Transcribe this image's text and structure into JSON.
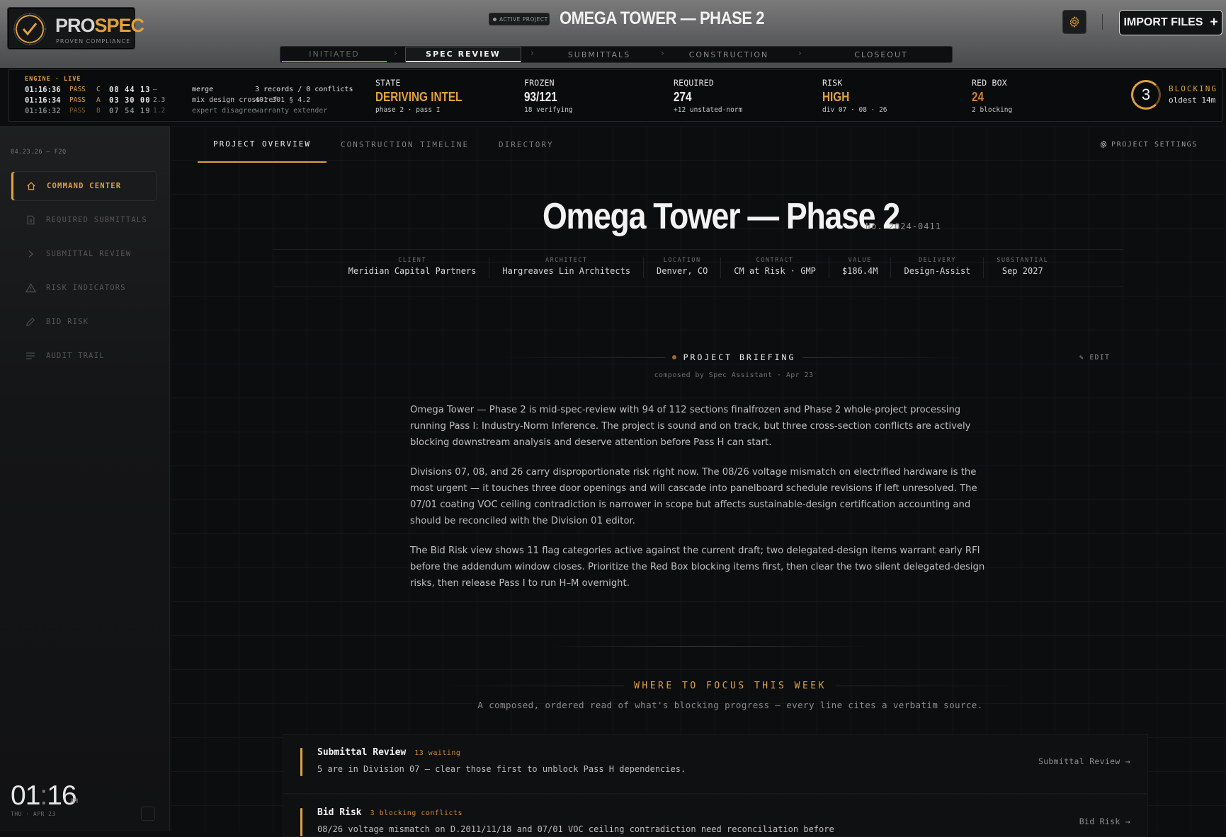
{
  "header": {
    "brand_part1": "PRO",
    "brand_part2": "SPEC",
    "tagline": "PROVEN COMPLIANCE",
    "active_badge": "ACTIVE PROJECT",
    "project_title": "OMEGA TOWER — PHASE 2",
    "import_label": "IMPORT FILES",
    "settings_icon": "gear-icon"
  },
  "pipeline": [
    {
      "label": "INITIATED",
      "state": "done"
    },
    {
      "label": "SPEC REVIEW",
      "state": "active"
    },
    {
      "label": "SUBMITTALS",
      "state": "pending"
    },
    {
      "label": "CONSTRUCTION",
      "state": "pending"
    },
    {
      "label": "CLOSEOUT",
      "state": "pending"
    }
  ],
  "engine": {
    "label": "ENGINE · LIVE",
    "rows": [
      {
        "time": "01:16:36",
        "status": "PASS",
        "code": "C",
        "num": "08 44 13",
        "delta": "—"
      },
      {
        "time": "01:16:34",
        "status": "PASS",
        "code": "A",
        "num": "03 30 00",
        "delta": "2.3"
      },
      {
        "time": "01:16:32",
        "status": "PASS",
        "code": "B",
        "num": "07 54 19",
        "delta": "1.2"
      }
    ],
    "merge": [
      "merge",
      "mix design cross-ref",
      "expert disagree"
    ],
    "records": [
      "3 records / 0 conflicts",
      "401 301 § 4.2",
      "warranty extender"
    ]
  },
  "stats": [
    {
      "key": "STATE",
      "value": "DERIVING INTEL",
      "sub": "phase 2 · pass I",
      "color": "#e0a13e"
    },
    {
      "key": "FROZEN",
      "value": "93/121",
      "sub": "18 verifying",
      "color": "#f0f0f0"
    },
    {
      "key": "REQUIRED",
      "value": "274",
      "sub": "+12 unstated-norm",
      "color": "#f0f0f0"
    },
    {
      "key": "RISK",
      "value": "HIGH",
      "sub": "div 07 · 08 · 26",
      "color": "#e0a13e"
    },
    {
      "key": "RED BOX",
      "value": "24",
      "sub": "2 blocking",
      "color": "#c9823a"
    }
  ],
  "blocking": {
    "count": "3",
    "label": "BLOCKING",
    "oldest": "oldest 14m"
  },
  "sidebar": {
    "date": "04.23.26 — F2Q",
    "items": [
      {
        "label": "COMMAND CENTER",
        "icon": "home-icon",
        "active": true
      },
      {
        "label": "REQUIRED SUBMITTALS",
        "icon": "document-icon",
        "active": false
      },
      {
        "label": "SUBMITTAL REVIEW",
        "icon": "chevron-right-icon",
        "active": false
      },
      {
        "label": "RISK INDICATORS",
        "icon": "warning-icon",
        "active": false
      },
      {
        "label": "BID RISK",
        "icon": "pencil-icon",
        "active": false
      },
      {
        "label": "AUDIT TRAIL",
        "icon": "list-icon",
        "active": false
      }
    ],
    "clock_h": "01",
    "clock_m": "16",
    "ampm": "AM",
    "clock_date": "THU · APR 23"
  },
  "tabs": [
    "PROJECT OVERVIEW",
    "CONSTRUCTION TIMELINE",
    "DIRECTORY"
  ],
  "project_settings": "PROJECT SETTINGS",
  "project": {
    "title": "Omega Tower — Phase 2",
    "number": "No. 2024-0411",
    "meta": [
      {
        "key": "CLIENT",
        "value": "Meridian Capital Partners"
      },
      {
        "key": "ARCHITECT",
        "value": "Hargreaves Lin Architects"
      },
      {
        "key": "LOCATION",
        "value": "Denver, CO"
      },
      {
        "key": "CONTRACT",
        "value": "CM at Risk · GMP"
      },
      {
        "key": "VALUE",
        "value": "$186.4M"
      },
      {
        "key": "DELIVERY",
        "value": "Design-Assist"
      },
      {
        "key": "SUBSTANTIAL",
        "value": "Sep 2027"
      }
    ]
  },
  "briefing": {
    "title": "PROJECT BRIEFING",
    "composed": "composed by Spec Assistant · Apr 23",
    "edit": "EDIT",
    "paragraphs": [
      "Omega Tower — Phase 2 is mid-spec-review with 94 of 112 sections finalfrozen and Phase 2 whole-project processing running Pass I: Industry-Norm Inference. The project is sound and on track, but three cross-section conflicts are actively blocking downstream analysis and deserve attention before Pass H can start.",
      "Divisions 07, 08, and 26 carry disproportionate risk right now. The 08/26 voltage mismatch on electrified hardware is the most urgent — it touches three door openings and will cascade into panelboard schedule revisions if left unresolved. The 07/01 coating VOC ceiling contradiction is narrower in scope but affects sustainable-design certification accounting and should be reconciled with the Division 01 editor.",
      "The Bid Risk view shows 11 flag categories active against the current draft; two delegated-design items warrant early RFI before the addendum window closes. Prioritize the Red Box blocking items first, then clear the two silent delegated-design risks, then release Pass I to run H–M overnight."
    ]
  },
  "focus": {
    "title": "WHERE TO FOCUS THIS WEEK",
    "subtitle": "A composed, ordered read of what's blocking progress — every line cites a verbatim source.",
    "items": [
      {
        "title": "Submittal Review",
        "count": "13 waiting",
        "desc": "5 are in Division 07 — clear those first to unblock Pass H dependencies.",
        "link": "Submittal Review →"
      },
      {
        "title": "Bid Risk",
        "count": "3 blocking conflicts",
        "desc": "08/26 voltage mismatch on D.2011/11/18 and 07/01 VOC ceiling contradiction need reconciliation before",
        "link": "Bid Risk →"
      }
    ]
  }
}
